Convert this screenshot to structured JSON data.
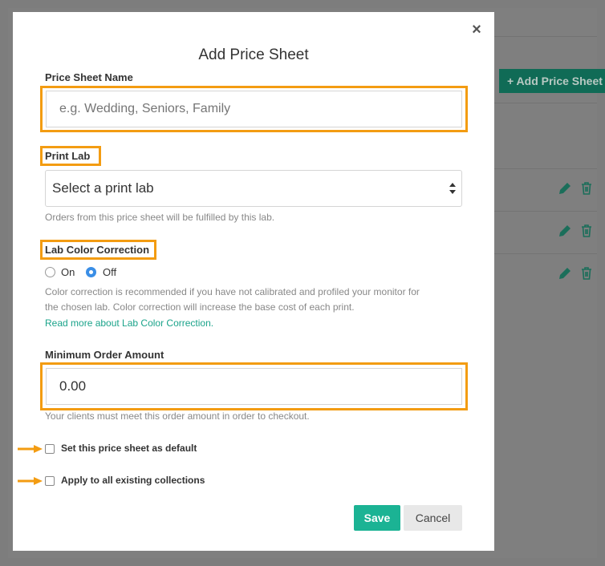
{
  "background": {
    "add_button_label": "+ Add Price Sheet",
    "row_actions": [
      "pencil-icon",
      "trash-icon"
    ]
  },
  "modal": {
    "title": "Add Price Sheet",
    "close_icon": "×",
    "price_sheet_name": {
      "label": "Price Sheet Name",
      "placeholder": "e.g. Wedding, Seniors, Family",
      "value": ""
    },
    "print_lab": {
      "label": "Print Lab",
      "selected": "Select a print lab",
      "help": "Orders from this price sheet will be fulfilled by this lab."
    },
    "color_correction": {
      "label": "Lab Color Correction",
      "options": [
        "On",
        "Off"
      ],
      "selected": "Off",
      "help_line1": "Color correction is recommended if you have not calibrated and profiled your monitor for",
      "help_line2": "the chosen lab. Color correction will increase the base cost of each print.",
      "link": "Read more about Lab Color Correction."
    },
    "minimum_order": {
      "label": "Minimum Order Amount",
      "value": "0.00",
      "help": "Your clients must meet this order amount in order to checkout."
    },
    "default_checkbox_label": "Set this price sheet as default",
    "apply_checkbox_label": "Apply to all existing collections",
    "save_label": "Save",
    "cancel_label": "Cancel"
  },
  "colors": {
    "highlight": "#f39c12",
    "accent": "#1bb394",
    "link": "#1aa38a",
    "radio_selected": "#3a8ee6"
  }
}
